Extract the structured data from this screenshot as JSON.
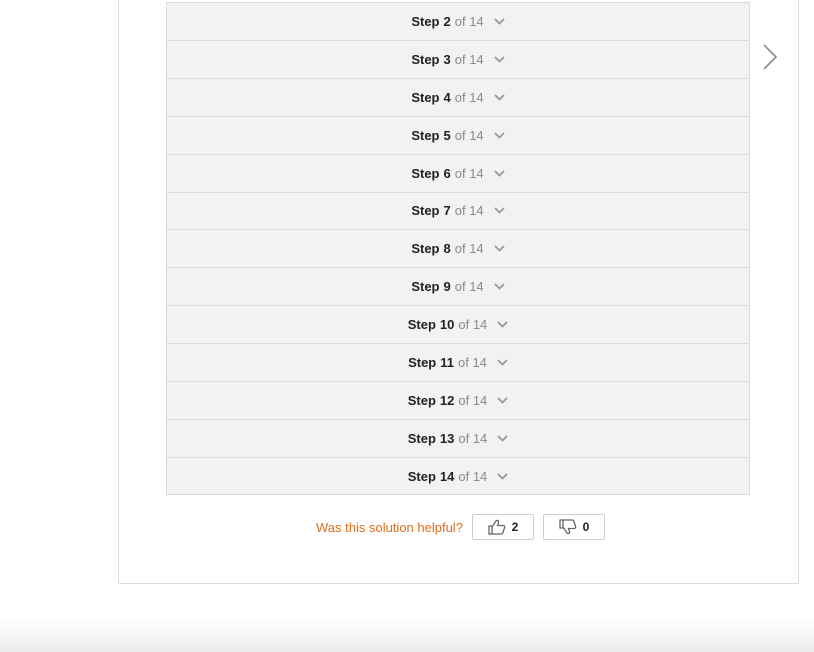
{
  "steps": {
    "label": "Step",
    "of_label": "of 14",
    "items": [
      {
        "number": "2"
      },
      {
        "number": "3"
      },
      {
        "number": "4"
      },
      {
        "number": "5"
      },
      {
        "number": "6"
      },
      {
        "number": "7"
      },
      {
        "number": "8"
      },
      {
        "number": "9"
      },
      {
        "number": "10"
      },
      {
        "number": "11"
      },
      {
        "number": "12"
      },
      {
        "number": "13"
      },
      {
        "number": "14"
      }
    ]
  },
  "feedback": {
    "question": "Was this solution helpful?",
    "thumbs_up_count": "2",
    "thumbs_down_count": "0"
  },
  "icons": {
    "step_chevron": "chevron-down-icon",
    "next": "chevron-right-icon",
    "up": "thumbs-up-icon",
    "down": "thumbs-down-icon"
  },
  "colors": {
    "accent": "#e06e1b",
    "step_background": "#f2f2f2",
    "border": "#dcdcdc"
  }
}
